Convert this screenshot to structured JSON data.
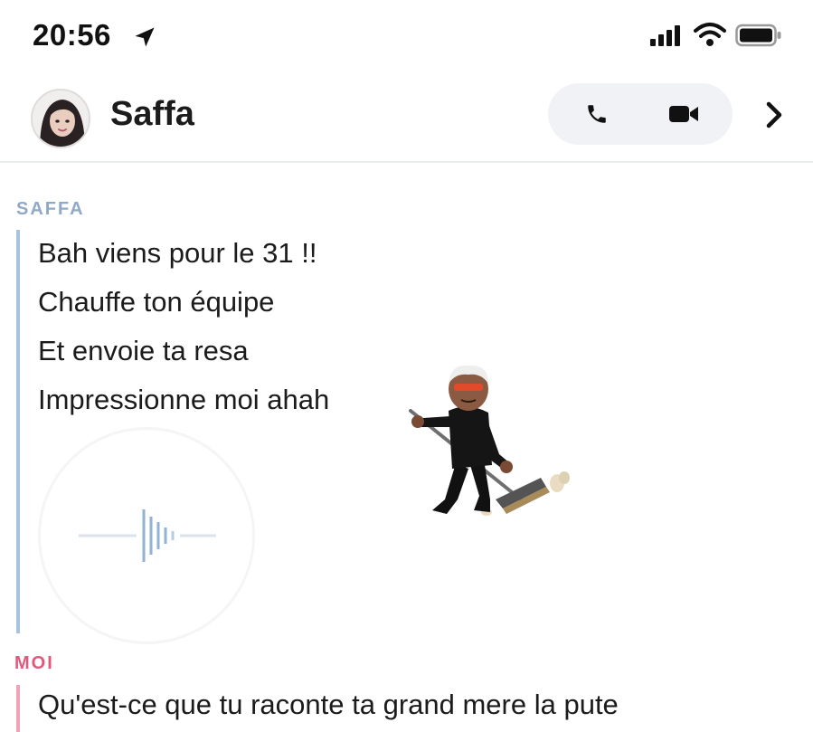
{
  "status_bar": {
    "time": "20:56",
    "icons": [
      "location-arrow-icon",
      "signal-icon",
      "wifi-icon",
      "battery-icon"
    ]
  },
  "header": {
    "contact_name": "Saffa",
    "avatar_icon": "avatar-bitmoji",
    "actions": [
      "phone-icon",
      "video-camera-icon",
      "chevron-right-icon"
    ]
  },
  "chat": {
    "received": {
      "sender": "SAFFA",
      "lines": [
        "Bah viens pour le 31 !!",
        "Chauffe ton équipe",
        "Et envoie ta resa",
        "Impressionne moi ahah"
      ],
      "sticker": "bitmoji-sweeping-sticker",
      "voice_note_icon": "audio-waveform-icon"
    },
    "sent": {
      "sender": "MOI",
      "lines": [
        "Qu'est-ce que tu raconte ta grand mere la pute"
      ]
    }
  },
  "colors": {
    "saffa_accent": "#a6c4e0",
    "saffa_label": "#8fa9c6",
    "moi_accent": "#f2a2b5",
    "moi_label": "#e2577a",
    "pill_bg": "#f0f2f6"
  }
}
